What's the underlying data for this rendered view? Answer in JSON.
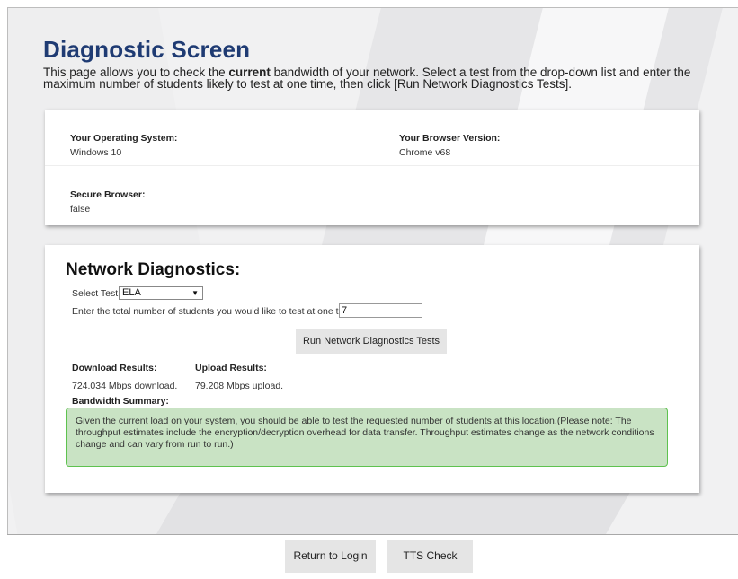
{
  "page": {
    "title": "Diagnostic Screen",
    "intro_before": "This page allows you to check the ",
    "intro_bold": "current",
    "intro_after": " bandwidth of your network. Select a test from the drop-down list and enter the maximum number of students likely to test at one time, then click [Run Network Diagnostics Tests]."
  },
  "system_info": {
    "os_label": "Your Operating System:",
    "os_value": "Windows 10",
    "browser_label": "Your Browser Version:",
    "browser_value": "Chrome v68",
    "secure_label": "Secure Browser:",
    "secure_value": "false"
  },
  "network": {
    "title": "Network Diagnostics:",
    "select_label": "Select Test:",
    "select_value": "ELA",
    "students_label": "Enter the total number of students you would like to test at one time:",
    "students_value": "7",
    "run_button": "Run Network Diagnostics Tests",
    "download_label": "Download Results:",
    "download_value": "724.034 Mbps download.",
    "upload_label": "Upload Results:",
    "upload_value": "79.208 Mbps upload.",
    "summary_label": "Bandwidth Summary:",
    "summary_text": "Given the current load on your system, you should be able to test the requested number of students at this location.(Please note: The throughput estimates include the encryption/decryption overhead for data transfer. Throughput estimates change as the network conditions change and can vary from run to run.)"
  },
  "footer": {
    "login_button": "Return to Login",
    "tts_button": "TTS Check"
  },
  "colors": {
    "title": "#1f3b73",
    "summary_bg": "#c9e3c4",
    "summary_border": "#5ec24f",
    "button_bg": "#e5e5e5"
  }
}
